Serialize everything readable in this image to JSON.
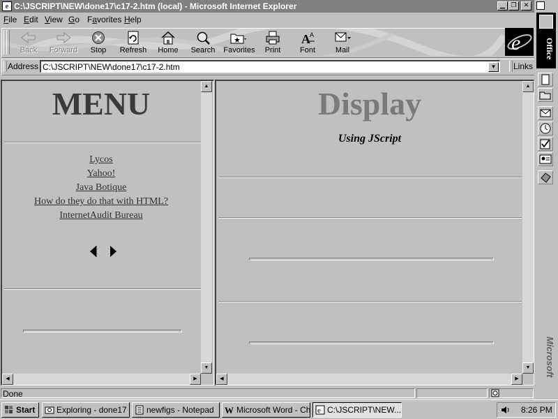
{
  "window": {
    "title": "C:\\JSCRIPT\\NEW\\done17\\c17-2.htm (local) - Microsoft Internet Explorer",
    "controls": [
      "minimize",
      "restore",
      "close"
    ]
  },
  "menubar": {
    "items": [
      {
        "label": "File",
        "accel": "F",
        "rest": "ile"
      },
      {
        "label": "Edit",
        "accel": "E",
        "rest": "dit"
      },
      {
        "label": "View",
        "accel": "V",
        "rest": "iew"
      },
      {
        "label": "Go",
        "accel": "G",
        "rest": "o"
      },
      {
        "label": "Favorites",
        "accel": "a",
        "pre": "F",
        "rest": "vorites"
      },
      {
        "label": "Help",
        "accel": "H",
        "rest": "elp"
      }
    ]
  },
  "toolbar": {
    "buttons": [
      {
        "label": "Back",
        "icon": "back-arrow-icon",
        "enabled": false
      },
      {
        "label": "Forward",
        "icon": "forward-arrow-icon",
        "enabled": false
      },
      {
        "label": "Stop",
        "icon": "stop-icon",
        "enabled": true
      },
      {
        "label": "Refresh",
        "icon": "refresh-icon",
        "enabled": true
      },
      {
        "label": "Home",
        "icon": "home-icon",
        "enabled": true
      },
      {
        "label": "Search",
        "icon": "search-icon",
        "enabled": true
      },
      {
        "label": "Favorites",
        "icon": "favorites-folder-icon",
        "enabled": true
      },
      {
        "label": "Print",
        "icon": "printer-icon",
        "enabled": true
      },
      {
        "label": "Font",
        "icon": "font-icon",
        "enabled": true
      },
      {
        "label": "Mail",
        "icon": "mail-icon",
        "enabled": true
      }
    ]
  },
  "address": {
    "label": "Address",
    "value": "C:\\JSCRIPT\\NEW\\done17\\c17-2.htm",
    "links_label": "Links"
  },
  "menu_frame": {
    "title": "MENU",
    "links": [
      "Lycos",
      "Yahoo!",
      "Java Botique",
      "How do they do that with HTML?",
      "InternetAudit Bureau"
    ],
    "nav_icons": [
      "left-triangle-icon",
      "right-triangle-icon"
    ]
  },
  "display_frame": {
    "title": "Display",
    "subtitle": "Using JScript"
  },
  "statusbar": {
    "text": "Done"
  },
  "officebar": {
    "title": "Office",
    "brand": "Microsoft"
  },
  "taskbar": {
    "start_label": "Start",
    "tasks": [
      {
        "label": "Exploring - done17",
        "active": false
      },
      {
        "label": "newfigs - Notepad",
        "active": false
      },
      {
        "label": "Microsoft Word - Ch...",
        "active": false
      },
      {
        "label": "C:\\JSCRIPT\\NEW...",
        "active": true
      }
    ],
    "clock": "8:26 PM"
  },
  "colors": {
    "face": "#c0c0c0",
    "titlebar_inactive": "#808080",
    "menu_title": "#3a3a3a",
    "display_title": "#7a7a7a"
  }
}
